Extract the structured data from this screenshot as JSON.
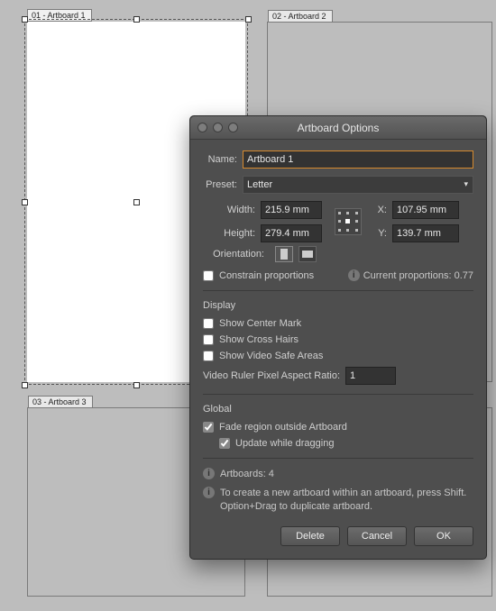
{
  "canvas": {
    "artboards": [
      {
        "id": 1,
        "label": "01 - Artboard 1"
      },
      {
        "id": 2,
        "label": "02 - Artboard 2"
      },
      {
        "id": 3,
        "label": "03 - Artboard 3"
      }
    ]
  },
  "dialog": {
    "title": "Artboard Options",
    "name_label": "Name:",
    "name_value": "Artboard 1",
    "preset_label": "Preset:",
    "preset_value": "Letter",
    "width_label": "Width:",
    "width_value": "215.9 mm",
    "height_label": "Height:",
    "height_value": "279.4 mm",
    "x_label": "X:",
    "x_value": "107.95 mm",
    "y_label": "Y:",
    "y_value": "139.7 mm",
    "orientation_label": "Orientation:",
    "constrain_label": "Constrain proportions",
    "proportions_label": "Current proportions: 0.77",
    "display_heading": "Display",
    "show_center_label": "Show Center Mark",
    "show_crosshairs_label": "Show Cross Hairs",
    "show_safe_label": "Show Video Safe Areas",
    "aspect_label": "Video Ruler Pixel Aspect Ratio:",
    "aspect_value": "1",
    "global_heading": "Global",
    "fade_label": "Fade region outside Artboard",
    "update_label": "Update while dragging",
    "artboards_count_label": "Artboards: 4",
    "hint_text": "To create a new artboard within an artboard, press Shift. Option+Drag to duplicate artboard.",
    "buttons": {
      "delete": "Delete",
      "cancel": "Cancel",
      "ok": "OK"
    }
  }
}
